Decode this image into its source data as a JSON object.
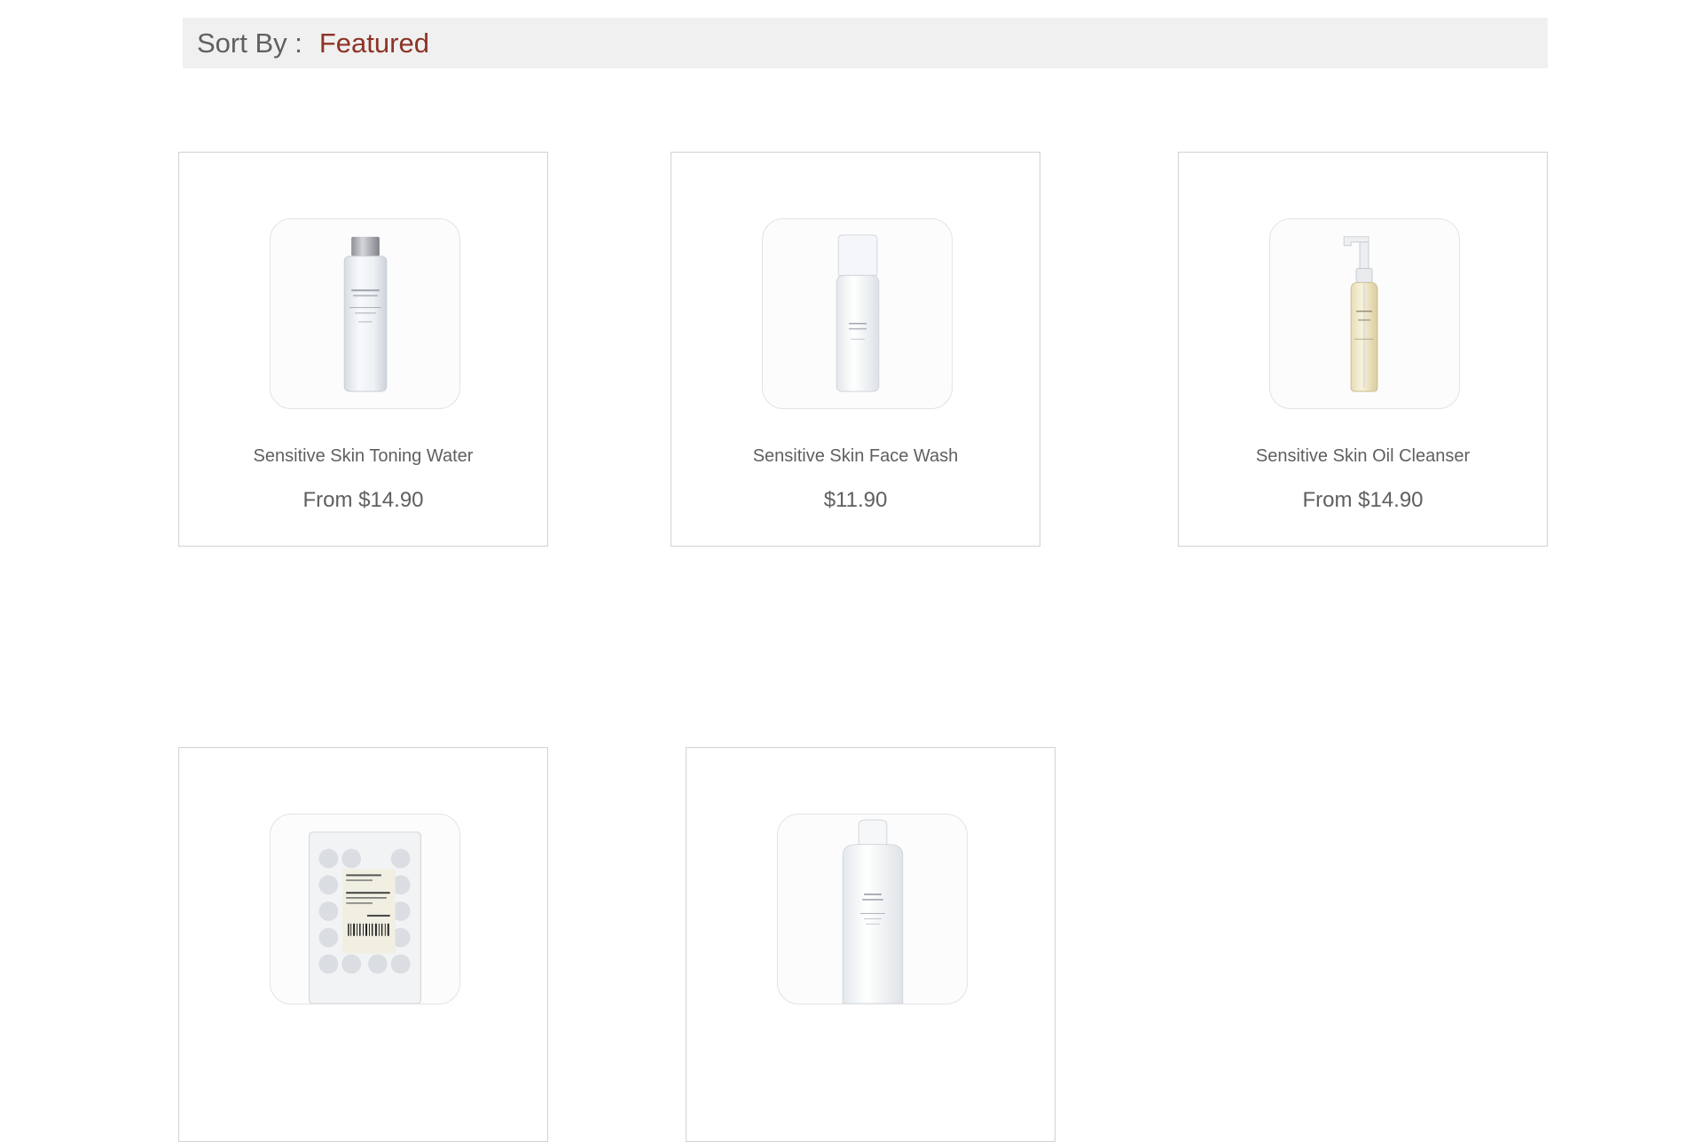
{
  "sort": {
    "label": "Sort By :",
    "value": "Featured"
  },
  "colors": {
    "accent": "#8e3326",
    "sort_bar_bg": "#f0f0f0",
    "text": "#5f5f5f",
    "card_border": "#d2d2d2"
  },
  "products": [
    {
      "name": "Sensitive Skin Toning Water",
      "price": "From $14.90",
      "image_icon": "toning-water-bottle-icon"
    },
    {
      "name": "Sensitive Skin Face Wash",
      "price": "$11.90",
      "image_icon": "face-wash-pump-bottle-icon"
    },
    {
      "name": "Sensitive Skin Oil Cleanser",
      "price": "From $14.90",
      "image_icon": "oil-cleanser-pump-bottle-icon"
    },
    {
      "name": "",
      "price": "",
      "image_icon": "compressed-face-mask-pack-icon"
    },
    {
      "name": "",
      "price": "",
      "image_icon": "body-milk-bottle-icon"
    }
  ]
}
